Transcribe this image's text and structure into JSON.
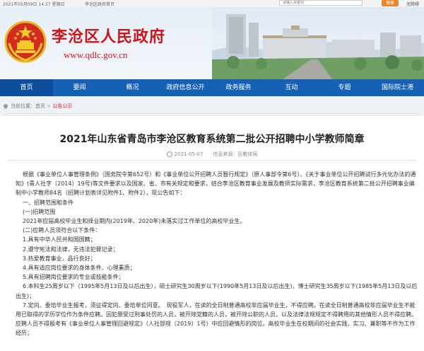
{
  "topbar": {
    "date": "2021年05月09日 14:27 星期日",
    "home_link": "李沧区政府首页",
    "search_placeholder": "请输入关键词",
    "search_button": "搜索",
    "access_link": "无障碍"
  },
  "header": {
    "site_name": "李沧区人民政府",
    "site_url": "www.qdlc.gov.cn"
  },
  "nav": {
    "items": [
      "首页",
      "要闻",
      "概况",
      "政府信息公开",
      "政务服务",
      "互动",
      "专题",
      "国际院士港"
    ],
    "active_index": 0
  },
  "breadcrumb": {
    "prefix": "当前位置：",
    "home": "首页",
    "separator": " > ",
    "current": "公告公示"
  },
  "article": {
    "title": "2021年山东省青岛市李沧区教育系统第二批公开招聘中小学教师简章",
    "date": "2021-05-07",
    "source": "信息来源：区教体局",
    "paragraphs": [
      "根据《事业单位人事管理条例》（国务院令第652号）和《事业单位公开招聘人员暂行规定》（原人事部令第6号）、《关于事业单位公开招聘试行多元化办法的通知》(青人社字〔2014〕19号)等文件要求以及国家、省、市有关规定和要求，结合李沧区教育事业发展及教师实际需求，李沧区教育系统第二批公开招聘事业编制中小学教师84名（招聘计划表详见附件1、附件2），现公告如下：",
      "一、招聘范围和条件",
      "(一)招聘范围",
      "2021年应届高校毕业生和择业期内(2019年、2020年)未落实过工作单位的高校毕业生。",
      "(二)应聘人员须符合以下条件：",
      "1.具有中华人民共和国国籍；",
      "2.遵守宪法和法律，无违法犯罪记录；",
      "3.热爱教育事业，品行良好；",
      "4.具有适应岗位要求的身体条件、心理素质；",
      "5.具有招聘岗位要求的专业或技能条件；",
      "6.本科生25周岁以下（1995年5月13日及以后出生），硕士研究生30周岁以下(1990年5月13日及以后出生)，博士研究生35周岁以下(1985年5月13日及以后出生)；",
      "7.定向、委培毕业生报考，须征得定向、委培单位同意。　现役军人，在读的全日制普通高校非应届毕业生，不得应聘。在读全日制普通高校非应届毕业生不能用已取得的学历学位作为条件应聘。因犯罪受过刑事处罚的人员，被开除党籍的人员，被开除公职的人员，以及法律法规规定不得聘用的其他情形人员不得应聘。应聘人员不得报考有《事业单位人事管理回避规定》（人社部规〔2019〕1号）中应回避情形的岗位。高校毕业生在校期间的社会实践、实习、兼职等不作为工作经历；"
    ]
  }
}
